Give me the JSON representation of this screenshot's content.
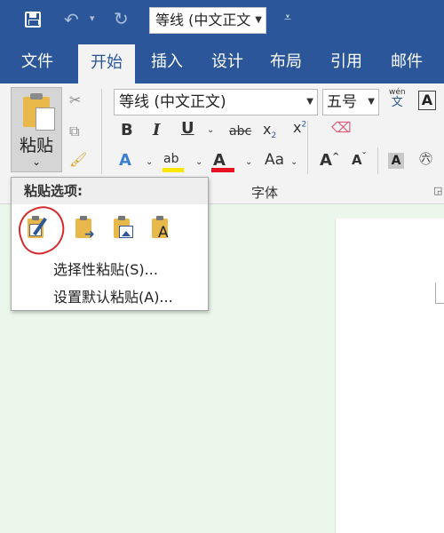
{
  "quick_access": {
    "font_combo_value": "等线 (中文正文"
  },
  "tabs": [
    {
      "label": "文件"
    },
    {
      "label": "开始"
    },
    {
      "label": "插入"
    },
    {
      "label": "设计"
    },
    {
      "label": "布局"
    },
    {
      "label": "引用"
    },
    {
      "label": "邮件"
    }
  ],
  "ribbon": {
    "paste_label": "粘贴",
    "font_name": "等线 (中文正文)",
    "font_size": "五号",
    "phonetic_small": "wén",
    "phonetic_char": "文",
    "font_group_label": "字体",
    "formatting": {
      "bold": "B",
      "italic": "I",
      "underline": "U",
      "strikethrough": "abc",
      "subscript": "x",
      "subscript_mark": "2",
      "superscript": "x",
      "superscript_mark": "2",
      "change_case": "Aa",
      "highlight": "ab",
      "font_color": "A",
      "grow": "A",
      "shrink": "A",
      "shading": "A",
      "char_border": "A",
      "enclose": "字"
    }
  },
  "paste_menu": {
    "header": "粘贴选项:",
    "options": [
      {
        "icon": "keep-source-formatting-icon"
      },
      {
        "icon": "merge-formatting-icon"
      },
      {
        "icon": "picture-icon"
      },
      {
        "icon": "keep-text-only-icon",
        "letter": "A"
      }
    ],
    "items": [
      {
        "label": "选择性粘贴(S)..."
      },
      {
        "label": "设置默认粘贴(A)..."
      }
    ]
  },
  "colors": {
    "brand": "#2b579a",
    "highlight": "#ffe600",
    "font_color": "#e81123",
    "annotation_circle": "#d42b2b"
  }
}
